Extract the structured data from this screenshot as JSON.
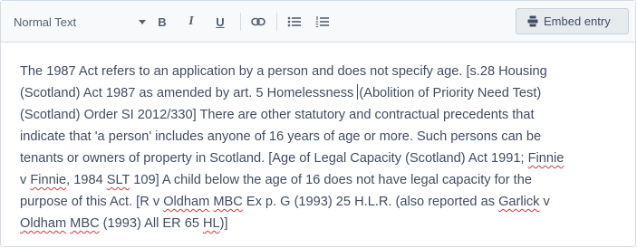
{
  "toolbar": {
    "format_select": "Normal Text",
    "bold_label": "B",
    "italic_label": "I",
    "underline_label": "U",
    "link_icon": "link-icon",
    "bullet_list_icon": "bulleted-list-icon",
    "numbered_list_icon": "numbered-list-icon",
    "embed_label": "Embed entry",
    "embed_icon": "embed-icon"
  },
  "body": {
    "l1": "The 1987 Act refers to an application by a person and does not specify age. [s.28 Housing",
    "l2a": "(Scotland) Act 1987 as amended by art. 5 Homelessness ",
    "l2b": "(Abolition of Priority Need Test)",
    "l3": "(Scotland) Order SI 2012/330] There are other statutory and contractual precedents that",
    "l4": "indicate that 'a person' includes anyone of 16 years of age or more. Such persons can be",
    "l5a": "tenants or owners of property in Scotland. [Age of Legal Capacity (Scotland) Act 1991; ",
    "l5b": "Finnie",
    "l6a": "v ",
    "l6b": "Finnie",
    "l6c": ", 1984 ",
    "l6d": "SLT",
    "l6e": " 109] A child below the age of 16 does not have legal capacity for the",
    "l7a": "purpose of this Act. [R v ",
    "l7b": "Oldham",
    "l7c": " ",
    "l7d": "MBC",
    "l7e": " Ex p. G (1993) 25 H.L.R. (also reported as ",
    "l7f": "Garlick",
    "l7g": " v",
    "l8a": "Oldham",
    "l8b": " ",
    "l8c": "MBC",
    "l8d": " (1993) All ER 65 ",
    "l8e": "HL",
    "l8f": ")]"
  },
  "colors": {
    "text": "#414d63",
    "toolbar_bg": "#f7f9fa",
    "border": "#d3dce6",
    "spellcheck": "#d23b3b"
  }
}
